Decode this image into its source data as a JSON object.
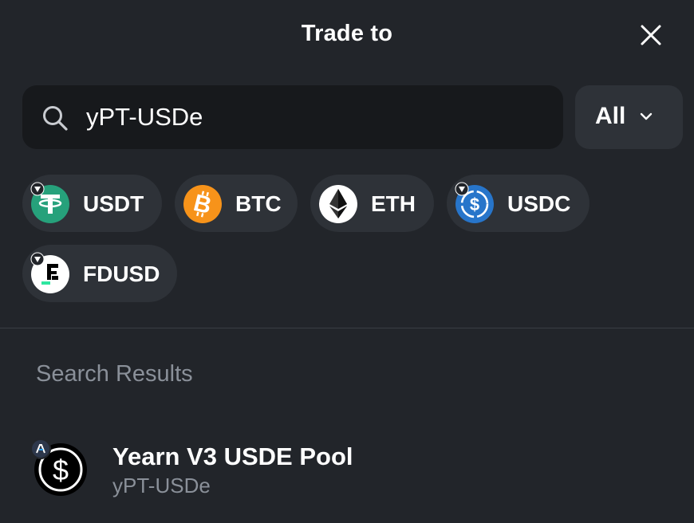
{
  "header": {
    "title": "Trade to"
  },
  "search": {
    "value": "yPT-USDe",
    "placeholder": ""
  },
  "filter": {
    "label": "All"
  },
  "quick_tokens": [
    {
      "symbol": "USDT",
      "icon": "tether-icon",
      "color": "#26a17b"
    },
    {
      "symbol": "BTC",
      "icon": "bitcoin-icon",
      "color": "#f7931a"
    },
    {
      "symbol": "ETH",
      "icon": "ethereum-icon",
      "color": "#ffffff"
    },
    {
      "symbol": "USDC",
      "icon": "usdc-icon",
      "color": "#2775ca"
    },
    {
      "symbol": "FDUSD",
      "icon": "fdusd-icon",
      "color": "#ffffff"
    }
  ],
  "results": {
    "section_title": "Search Results",
    "items": [
      {
        "name": "Yearn V3 USDE Pool",
        "symbol": "yPT-USDe",
        "icon": "usde-icon",
        "network_icon": "arbitrum-icon"
      }
    ]
  }
}
